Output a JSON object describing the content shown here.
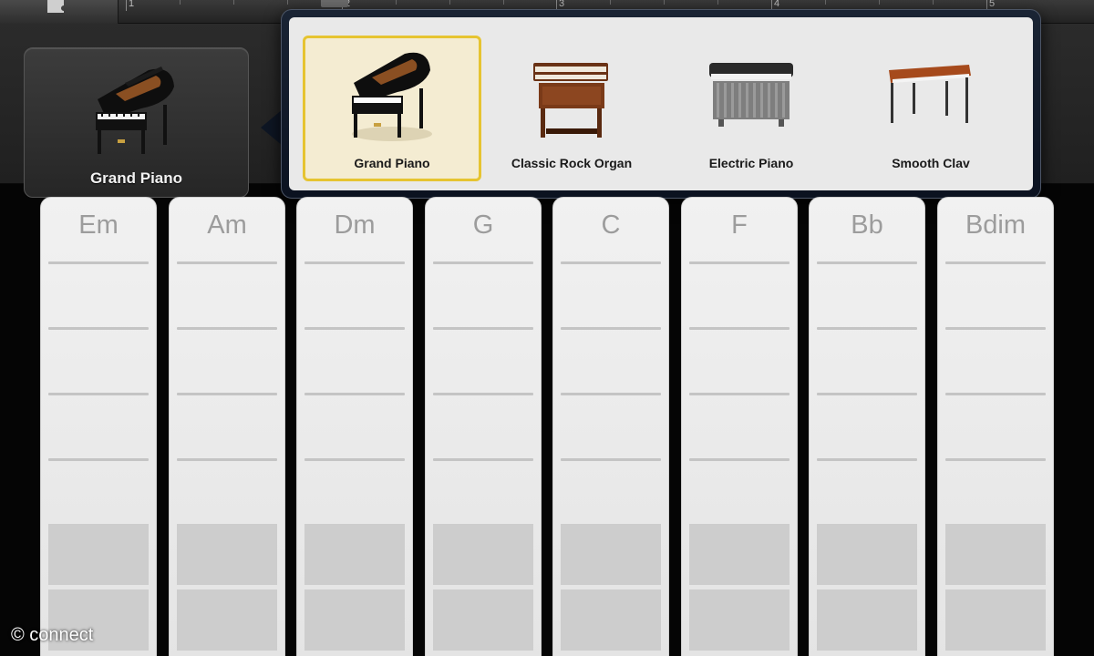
{
  "ruler": {
    "bars": [
      "1",
      "2",
      "3",
      "4",
      "5"
    ]
  },
  "current_instrument": {
    "label": "Grand Piano",
    "icon": "grand-piano-icon"
  },
  "instrument_picker": {
    "items": [
      {
        "label": "Grand Piano",
        "icon": "grand-piano-icon",
        "selected": true
      },
      {
        "label": "Classic Rock Organ",
        "icon": "organ-icon",
        "selected": false
      },
      {
        "label": "Electric Piano",
        "icon": "electric-piano-icon",
        "selected": false
      },
      {
        "label": "Smooth Clav",
        "icon": "clavinet-icon",
        "selected": false
      }
    ],
    "selection_color": "#e6c431"
  },
  "chords": [
    "Em",
    "Am",
    "Dm",
    "G",
    "C",
    "F",
    "Bb",
    "Bdim"
  ],
  "watermark": "© connect"
}
